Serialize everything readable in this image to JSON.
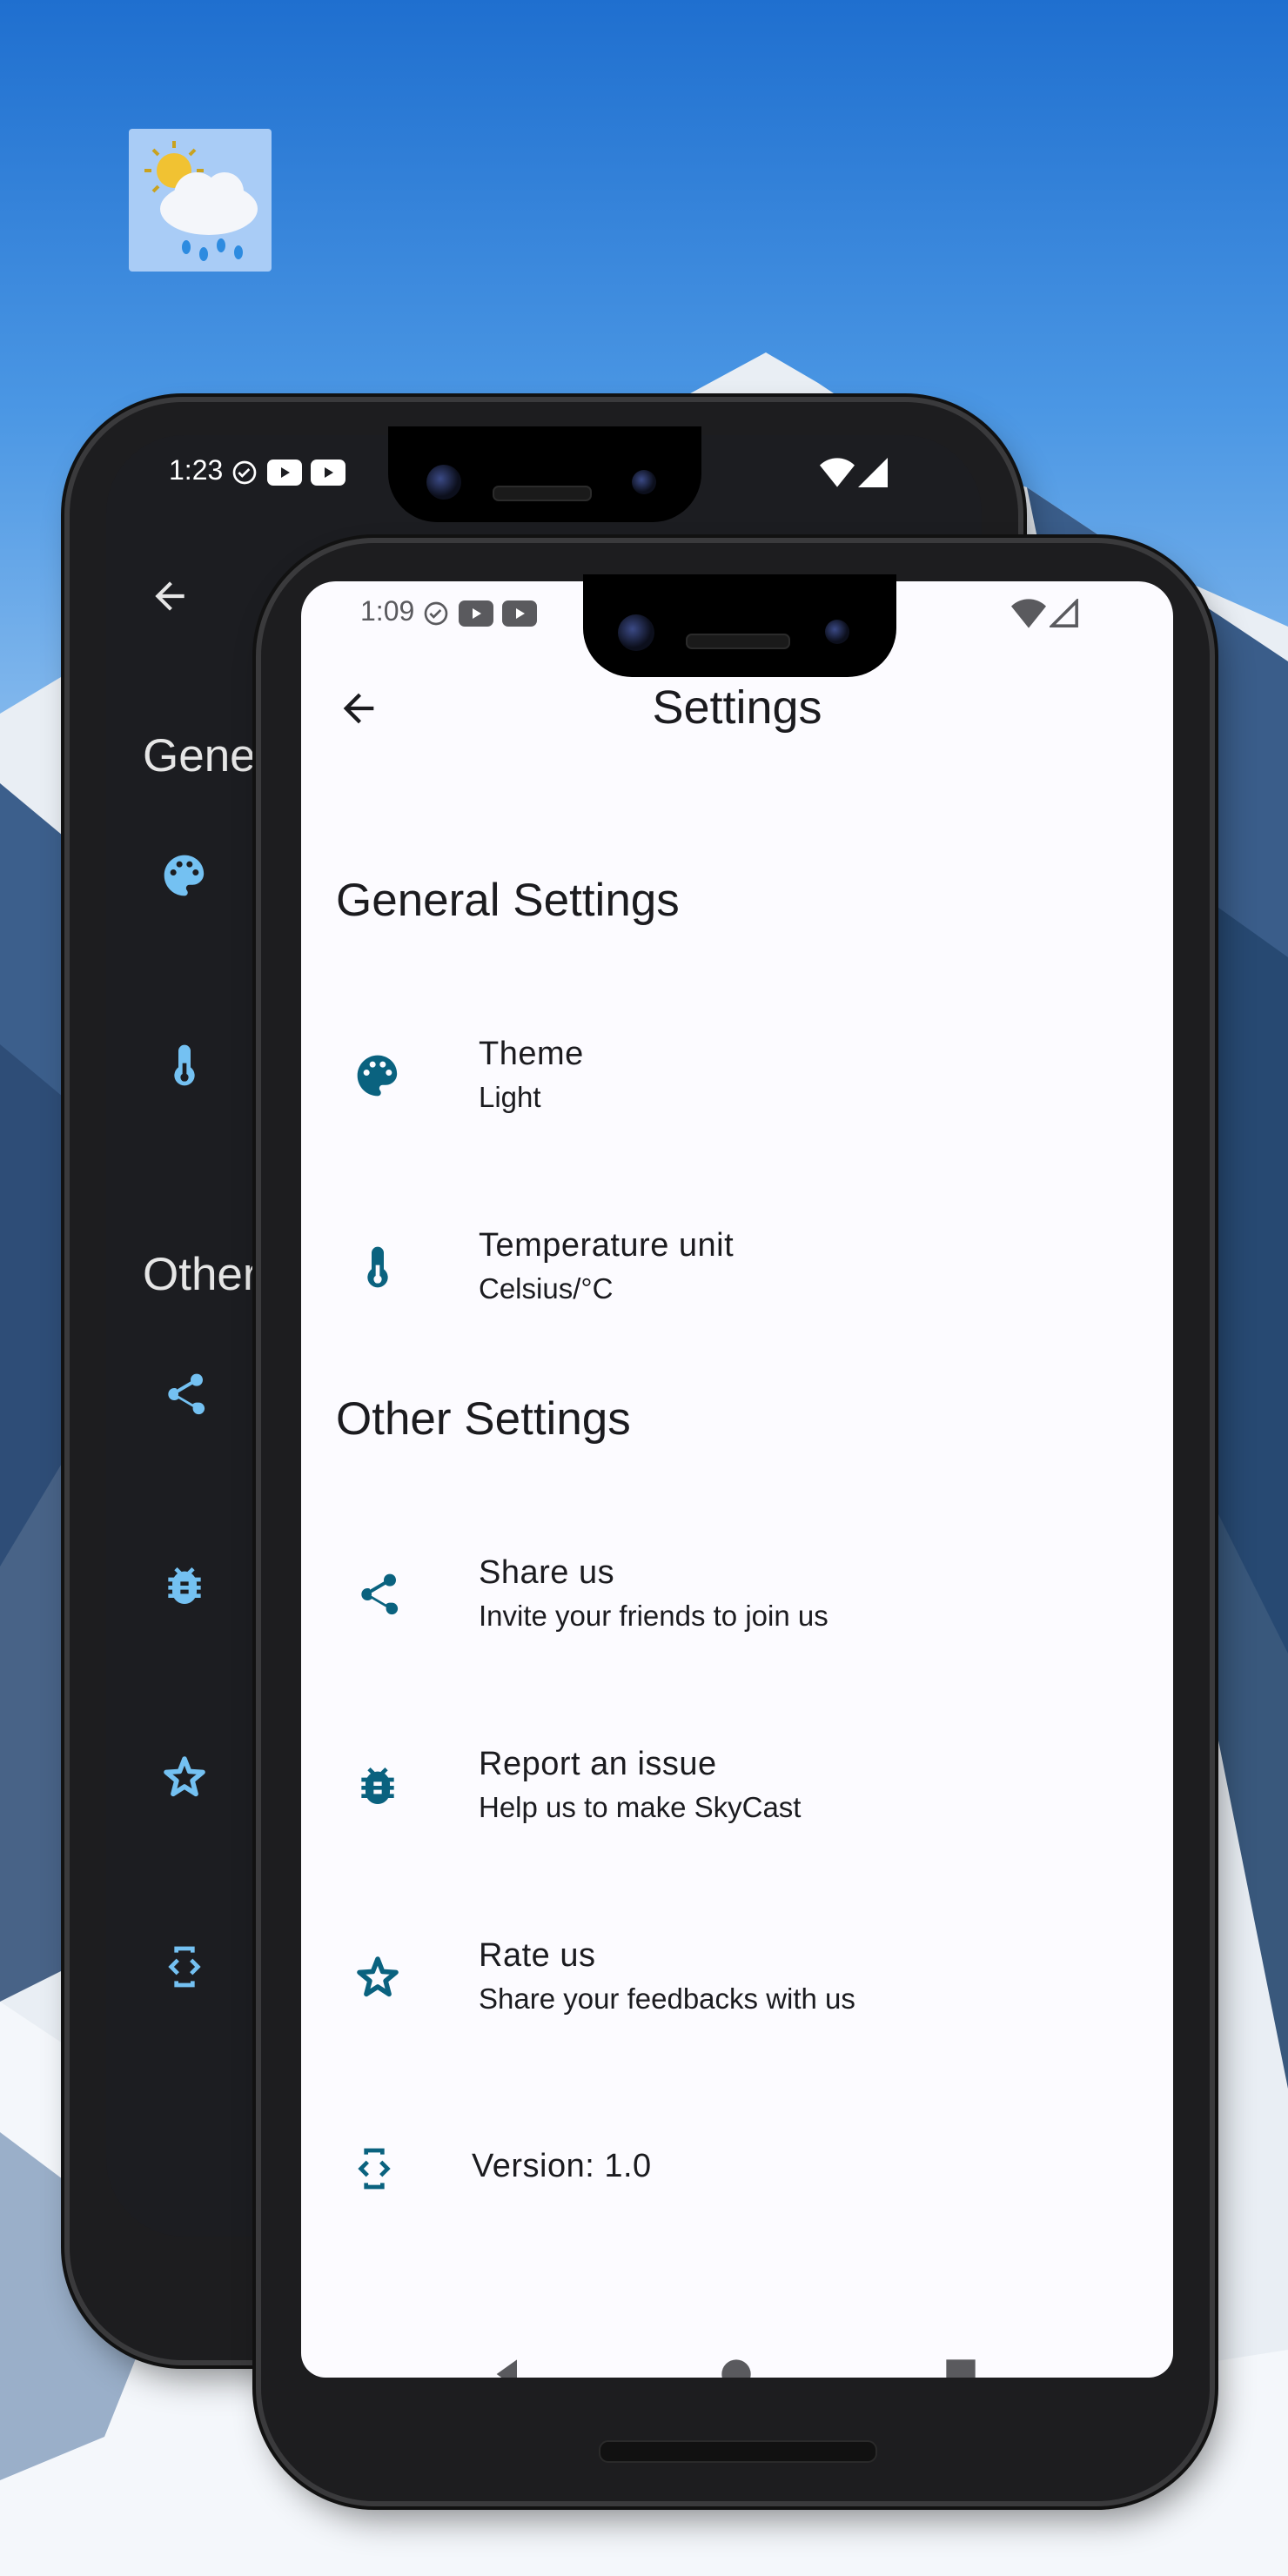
{
  "colors": {
    "accent_light": "#0a627f",
    "accent_dark": "#74c1f2",
    "dark_surface": "#1c1d21"
  },
  "app_logo_icon": "weather-sun-rain-icon",
  "back_phone": {
    "status": {
      "time": "1:23"
    },
    "section_general_partial": "Gener",
    "section_other_partial": "Other"
  },
  "front_phone": {
    "status": {
      "time": "1:09"
    },
    "title": "Settings",
    "sections": [
      {
        "title": "General Settings",
        "items": [
          {
            "icon": "palette-icon",
            "title": "Theme",
            "subtitle": "Light"
          },
          {
            "icon": "thermometer-icon",
            "title": "Temperature unit",
            "subtitle": "Celsius/°C"
          }
        ]
      },
      {
        "title": "Other Settings",
        "items": [
          {
            "icon": "share-icon",
            "title": "Share us",
            "subtitle": "Invite your friends to join us"
          },
          {
            "icon": "bug-icon",
            "title": "Report an issue",
            "subtitle": "Help us to make SkyCast"
          },
          {
            "icon": "star-icon",
            "title": "Rate us",
            "subtitle": "Share your feedbacks with us"
          }
        ]
      }
    ],
    "version": "Version: 1.0"
  }
}
